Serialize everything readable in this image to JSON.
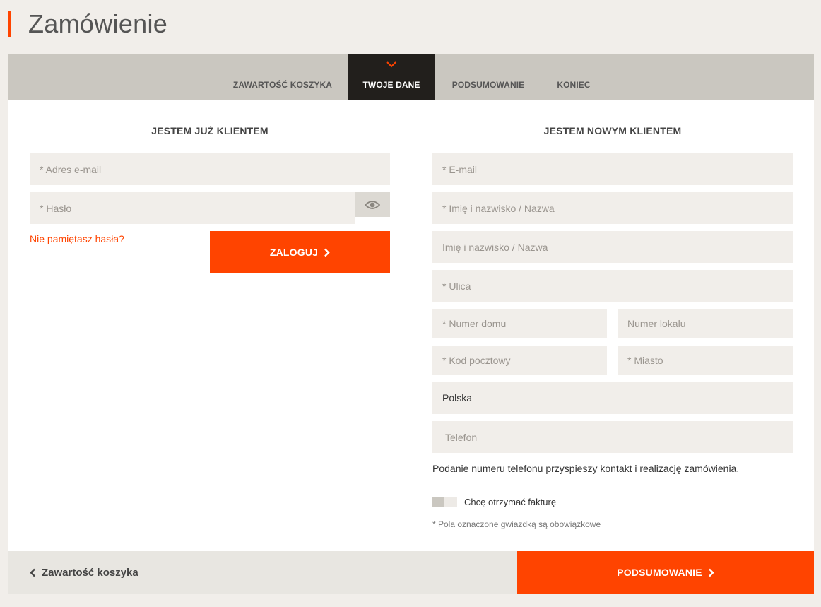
{
  "page": {
    "title": "Zamówienie"
  },
  "steps": [
    {
      "label": "ZAWARTOŚĆ KOSZYKA",
      "active": false
    },
    {
      "label": "TWOJE DANE",
      "active": true
    },
    {
      "label": "PODSUMOWANIE",
      "active": false
    },
    {
      "label": "KONIEC",
      "active": false
    }
  ],
  "login": {
    "title": "JESTEM JUŻ KLIENTEM",
    "email_placeholder": "* Adres e-mail",
    "password_placeholder": "* Hasło",
    "forgot_label": "Nie pamiętasz hasła?",
    "submit_label": "ZALOGUJ"
  },
  "register": {
    "title": "JESTEM NOWYM KLIENTEM",
    "email_placeholder": "* E-mail",
    "name_placeholder": "* Imię i nazwisko / Nazwa",
    "name2_placeholder": "Imię i nazwisko / Nazwa",
    "street_placeholder": "* Ulica",
    "house_placeholder": "* Numer domu",
    "flat_placeholder": "Numer lokalu",
    "zip_placeholder": "* Kod pocztowy",
    "city_placeholder": "* Miasto",
    "country_value": "Polska",
    "phone_placeholder": "Telefon",
    "phone_note": "Podanie numeru telefonu przyspieszy kontakt i realizację zamówienia.",
    "invoice_label": "Chcę otrzymać fakturę",
    "invoice_checked": false,
    "required_note": "* Pola oznaczone gwiazdką są obowiązkowe"
  },
  "footer": {
    "back_label": "Zawartość koszyka",
    "next_label": "PODSUMOWANIE"
  },
  "colors": {
    "accent": "#ff4400",
    "dark": "#221f1c",
    "field_bg": "#f1eeea",
    "bar": "#cac7c0"
  }
}
